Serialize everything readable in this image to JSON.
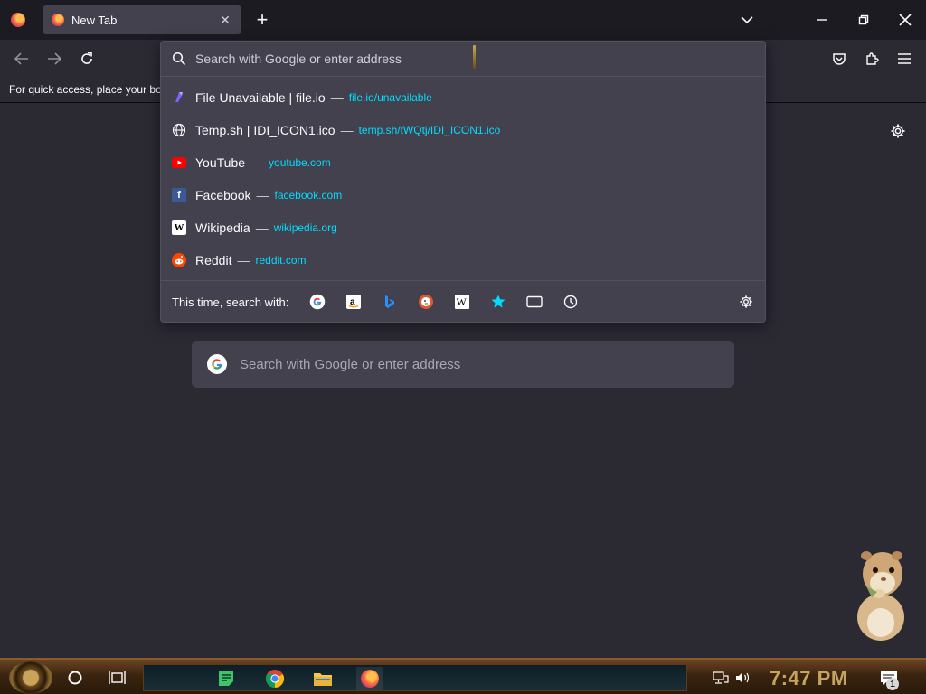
{
  "browser": {
    "tab": {
      "title": "New Tab"
    },
    "bookmarks_hint": "For quick access, place your boo"
  },
  "urlbar": {
    "placeholder": "Search with Google or enter address",
    "suggestions": [
      {
        "title": "File Unavailable | file.io",
        "url": "file.io/unavailable",
        "icon": "fileio-icon"
      },
      {
        "title": "Temp.sh | IDI_ICON1.ico",
        "url": "temp.sh/tWQtj/IDI_ICON1.ico",
        "icon": "globe-icon"
      },
      {
        "title": "YouTube",
        "url": "youtube.com",
        "icon": "youtube-icon"
      },
      {
        "title": "Facebook",
        "url": "facebook.com",
        "icon": "facebook-icon"
      },
      {
        "title": "Wikipedia",
        "url": "wikipedia.org",
        "icon": "wikipedia-icon"
      },
      {
        "title": "Reddit",
        "url": "reddit.com",
        "icon": "reddit-icon"
      }
    ],
    "separator": "—",
    "oneoff_label": "This time, search with:",
    "engines": [
      "google-icon",
      "amazon-icon",
      "bing-icon",
      "duckduckgo-icon",
      "wikipedia-icon",
      "bookmarks-star-icon",
      "tabs-icon",
      "history-icon"
    ]
  },
  "newtab": {
    "search_placeholder": "Search with Google or enter address"
  },
  "taskbar": {
    "clock": "7:47 PM",
    "notification_count": "1"
  },
  "colors": {
    "accent_link": "#00ddff",
    "panel_bg": "#42414d",
    "page_bg": "#2b2a33",
    "clock": "#c5a45e"
  }
}
